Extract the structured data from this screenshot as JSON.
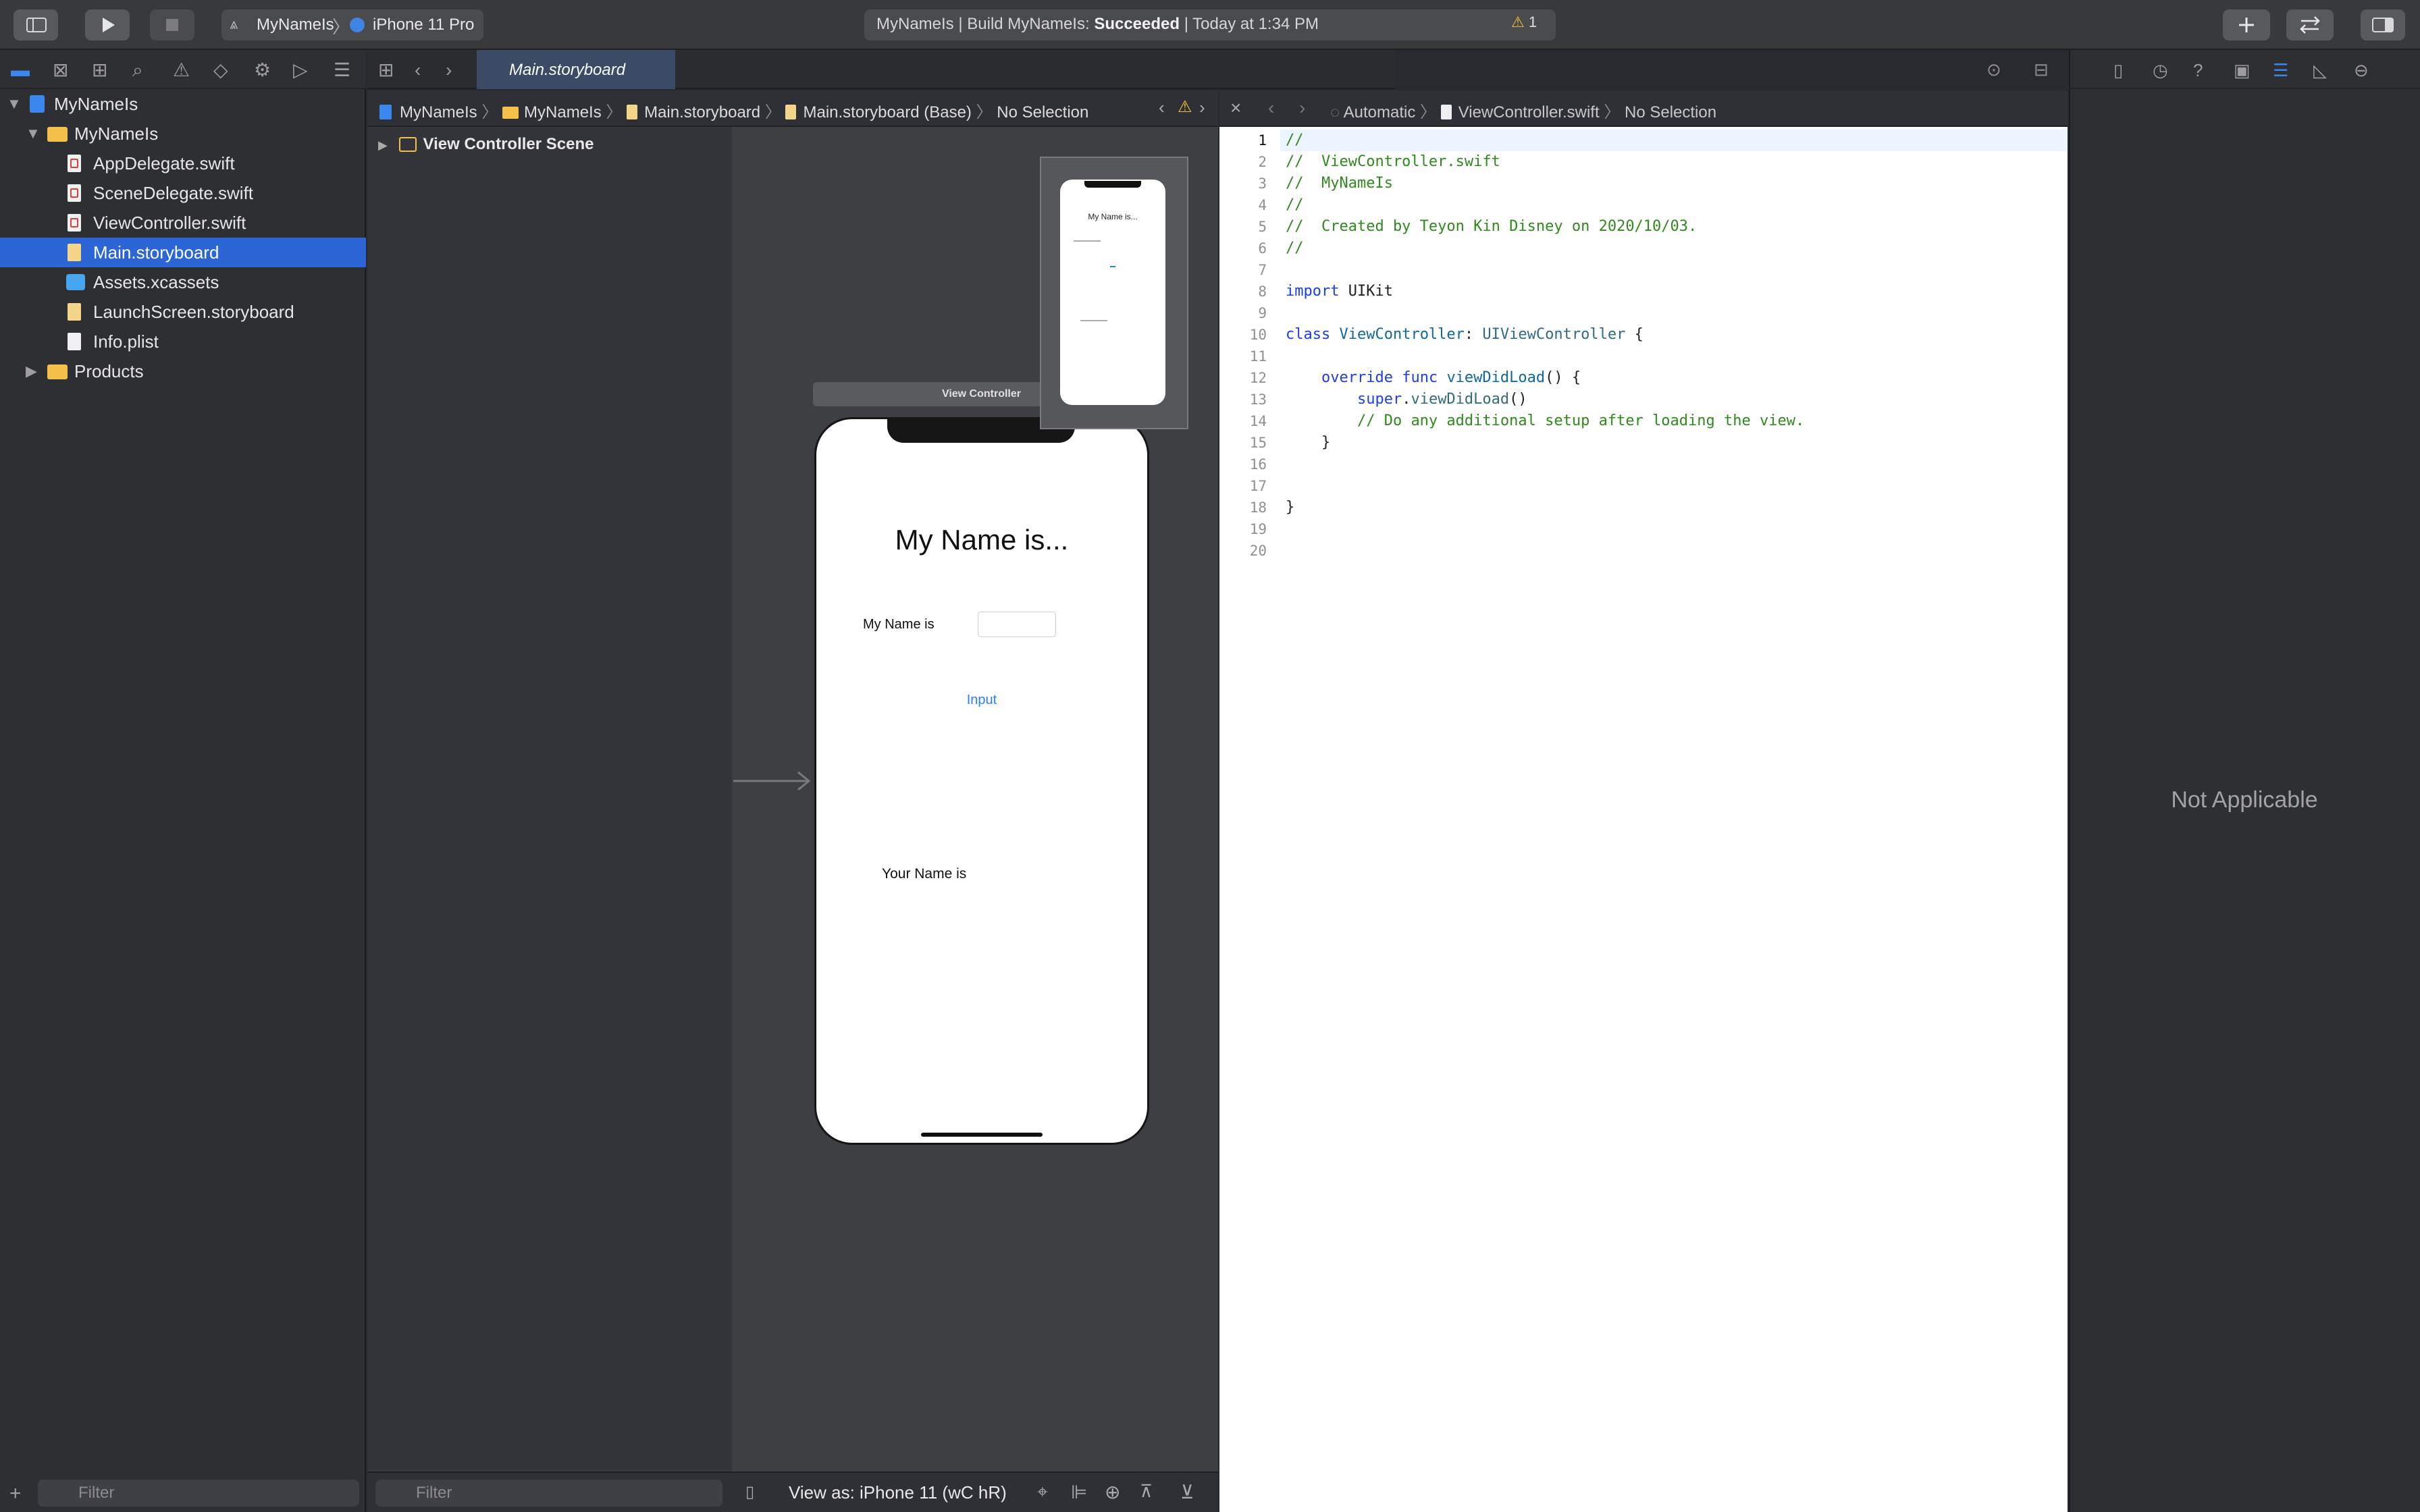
{
  "toolbar": {
    "scheme_project": "MyNameIs",
    "scheme_device": "iPhone 11 Pro",
    "status_project": "MyNameIs | Build MyNameIs: ",
    "status_result": "Succeeded",
    "status_time": " | Today at 1:34 PM",
    "warning_count": "1"
  },
  "navigator": {
    "root": "MyNameIs",
    "group": "MyNameIs",
    "files": [
      {
        "label": "AppDelegate.swift"
      },
      {
        "label": "SceneDelegate.swift"
      },
      {
        "label": "ViewController.swift"
      },
      {
        "label": "Main.storyboard"
      },
      {
        "label": "Assets.xcassets"
      },
      {
        "label": "LaunchScreen.storyboard"
      },
      {
        "label": "Info.plist"
      }
    ],
    "products": "Products",
    "selected": "Main.storyboard",
    "filter_placeholder": "Filter"
  },
  "editor": {
    "tab_label": "Main.storyboard",
    "jumpbar": [
      "MyNameIs",
      "MyNameIs",
      "Main.storyboard",
      "Main.storyboard (Base)",
      "No Selection"
    ],
    "outline_scene": "View Controller Scene",
    "outline_filter_placeholder": "Filter",
    "view_as": "View as: iPhone 11 (",
    "view_as_sizes": "wC hR)",
    "scene_bar_label": "View Controller"
  },
  "storyboard_ui": {
    "title": "My Name is...",
    "field_label": "My Name is",
    "button": "Input",
    "result_label": "Your Name is"
  },
  "assistant": {
    "jumpbar_mode": "Automatic",
    "jumpbar_file": "ViewController.swift",
    "jumpbar_sel": "No Selection",
    "code_lines": [
      "//",
      "//  ViewController.swift",
      "//  MyNameIs",
      "//",
      "//  Created by Teyon Kin Disney on 2020/10/03.",
      "//",
      "",
      "import UIKit",
      "",
      "class ViewController: UIViewController {",
      "",
      "    override func viewDidLoad() {",
      "        super.viewDidLoad()",
      "        // Do any additional setup after loading the view.",
      "    }",
      "",
      "",
      "}",
      "",
      ""
    ],
    "line_numbers": [
      "1",
      "2",
      "3",
      "4",
      "5",
      "6",
      "7",
      "8",
      "9",
      "10",
      "11",
      "12",
      "13",
      "14",
      "15",
      "16",
      "17",
      "18",
      "19",
      "20"
    ]
  },
  "inspector": {
    "message": "Not Applicable"
  },
  "colors": {
    "accent": "#2c65d6",
    "comment": "#2f8a1e",
    "keyword": "#1d3ee0",
    "link": "#2c7cf5"
  }
}
